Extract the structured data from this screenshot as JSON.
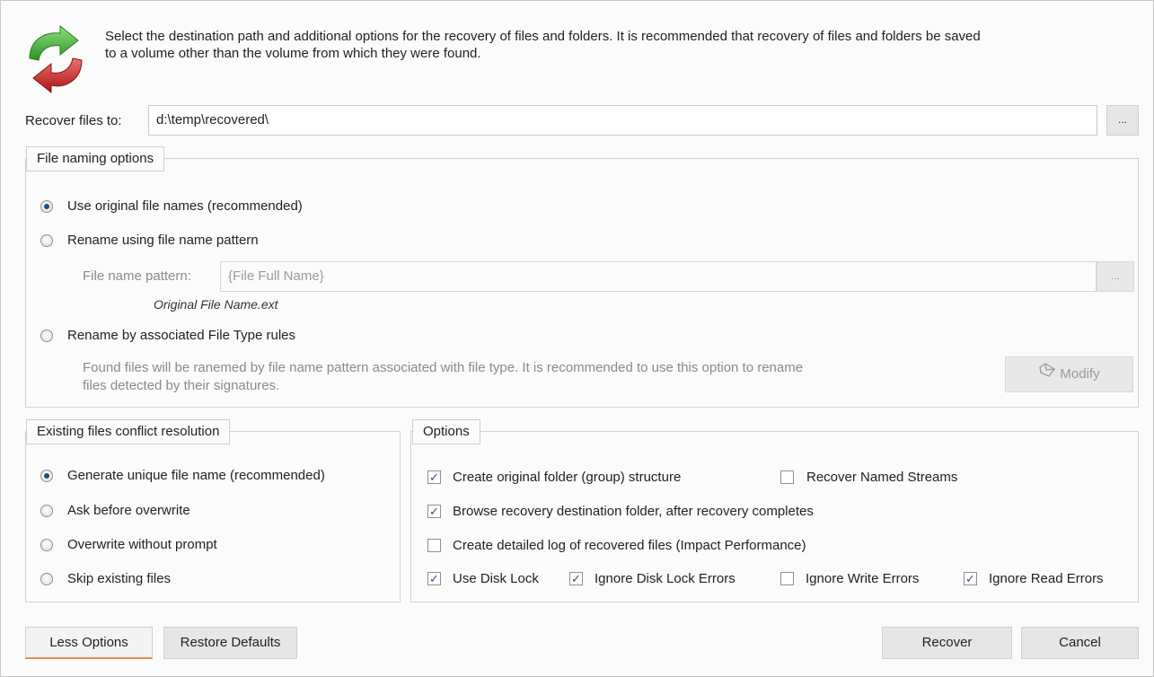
{
  "intro": {
    "line1": "Select the destination path and additional options for the recovery of files and folders.  It is recommended that recovery of files and folders be saved",
    "line2": "to a volume other than the volume from which they were found."
  },
  "destination": {
    "label": "Recover files to:",
    "value": "d:\\temp\\recovered\\",
    "browse_label": "..."
  },
  "file_naming": {
    "legend": "File naming options",
    "original_label": "Use original file names (recommended)",
    "pattern_label": "Rename using file name pattern",
    "pattern_field_label": "File name pattern:",
    "pattern_value": "{File Full Name}",
    "pattern_browse": "...",
    "pattern_preview": "Original File Name.ext",
    "filetype_label": "Rename by associated File Type rules",
    "filetype_desc1": "Found files will be ranemed by file name pattern associated with file type. It is recommended to use this option to rename",
    "filetype_desc2": "files detected by their signatures.",
    "modify_label": "Modify",
    "selected": "original"
  },
  "conflict": {
    "legend": "Existing files conflict resolution",
    "items": [
      {
        "label": "Generate unique file name (recommended)",
        "selected": true
      },
      {
        "label": "Ask before overwrite",
        "selected": false
      },
      {
        "label": "Overwrite without prompt",
        "selected": false
      },
      {
        "label": "Skip existing files",
        "selected": false
      }
    ]
  },
  "options": {
    "legend": "Options",
    "create_structure": {
      "label": "Create original folder (group) structure",
      "checked": true
    },
    "named_streams": {
      "label": "Recover Named Streams",
      "checked": false
    },
    "browse_after": {
      "label": "Browse recovery destination folder, after recovery completes",
      "checked": true
    },
    "detailed_log": {
      "label": "Create detailed log of recovered files (Impact Performance)",
      "checked": false
    },
    "disk_lock": {
      "label": "Use Disk Lock",
      "checked": true
    },
    "ignore_disk_lock": {
      "label": "Ignore Disk Lock Errors",
      "checked": true
    },
    "ignore_write": {
      "label": "Ignore Write Errors",
      "checked": false
    },
    "ignore_read": {
      "label": "Ignore Read Errors",
      "checked": true
    }
  },
  "footer": {
    "less_options": "Less Options",
    "restore_defaults": "Restore Defaults",
    "recover": "Recover",
    "cancel": "Cancel"
  },
  "colors": {
    "check_mark": "#2c4f86",
    "radio_dot": "#1a4d8c",
    "focus_underline": "#e88b52",
    "icon_green": "#3fa43a",
    "icon_red": "#d02b2b"
  }
}
